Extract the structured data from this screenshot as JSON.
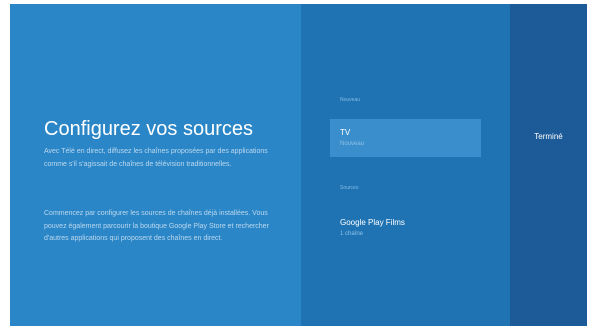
{
  "setup": {
    "title": "Configurez vos sources",
    "paragraph1": "Avec Télé en direct, diffusez les chaînes proposées par des applications comme s'il s'agissait de chaînes de télévision traditionnelles.",
    "paragraph2": "Commencez par configurer les sources de chaînes déjà installées. Vous pouvez également parcourir la boutique Google Play Store et rechercher d'autres applications qui proposent des chaînes en direct."
  },
  "sources_list": {
    "new_section_label": "Nouveau",
    "new_items": [
      {
        "title": "TV",
        "subtitle": "Nouveau"
      }
    ],
    "sources_section_label": "Sources",
    "source_items": [
      {
        "title": "Google Play Films",
        "subtitle": "1 chaîne"
      }
    ]
  },
  "actions": {
    "done_label": "Terminé"
  },
  "colors": {
    "left_panel": "#2a86c7",
    "middle_panel": "#1f73b3",
    "right_panel": "#1c5b98",
    "focused_item": "#3a8ecb"
  }
}
